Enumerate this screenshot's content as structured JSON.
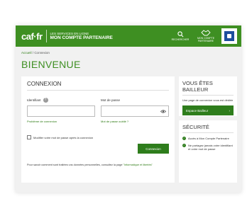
{
  "header": {
    "logo": "caf·fr",
    "subtitle_top": "LES SERVICES EN LIGNE",
    "subtitle_main": "MON COMPTE PARTENAIRE",
    "tools": [
      {
        "label": "RECHERCHER",
        "icon": "search-icon"
      },
      {
        "label": "MON COMPTE PARTENAIRE",
        "icon": "handshake-icon"
      }
    ]
  },
  "breadcrumb": {
    "home": "Accueil",
    "separator": "/",
    "current": "Connexion"
  },
  "page_title": "BIENVENUE",
  "login": {
    "title": "CONNEXION",
    "identifier_label": "Identifiant",
    "identifier_value": "",
    "identifier_link": "Problème de connexion",
    "password_label": "Mot de passe",
    "password_value": "",
    "password_link": "Mot de passe oublié ?",
    "checkbox_label": "Modifier votre mot de passe après la connexion",
    "submit_label": "Connexion",
    "info_text": "Pour savoir comment sont traitées vos données personnelles, consultez la page",
    "info_link": "\"Informatique et libertés\""
  },
  "bailleur": {
    "title": "VOUS ÊTES BAILLEUR",
    "text": "Une page de connexion vous est dédiée",
    "button_label": "Espace Bailleur"
  },
  "security": {
    "title": "SÉCURITÉ",
    "items": [
      "Accès à Mon Compte Partenaire",
      "Ne partagez jamais votre identifiant et votre mot de passe"
    ]
  },
  "colors": {
    "brand_green": "#3e8f22",
    "button_green": "#2e7d1c",
    "flag_blue": "#1d4e9e"
  }
}
